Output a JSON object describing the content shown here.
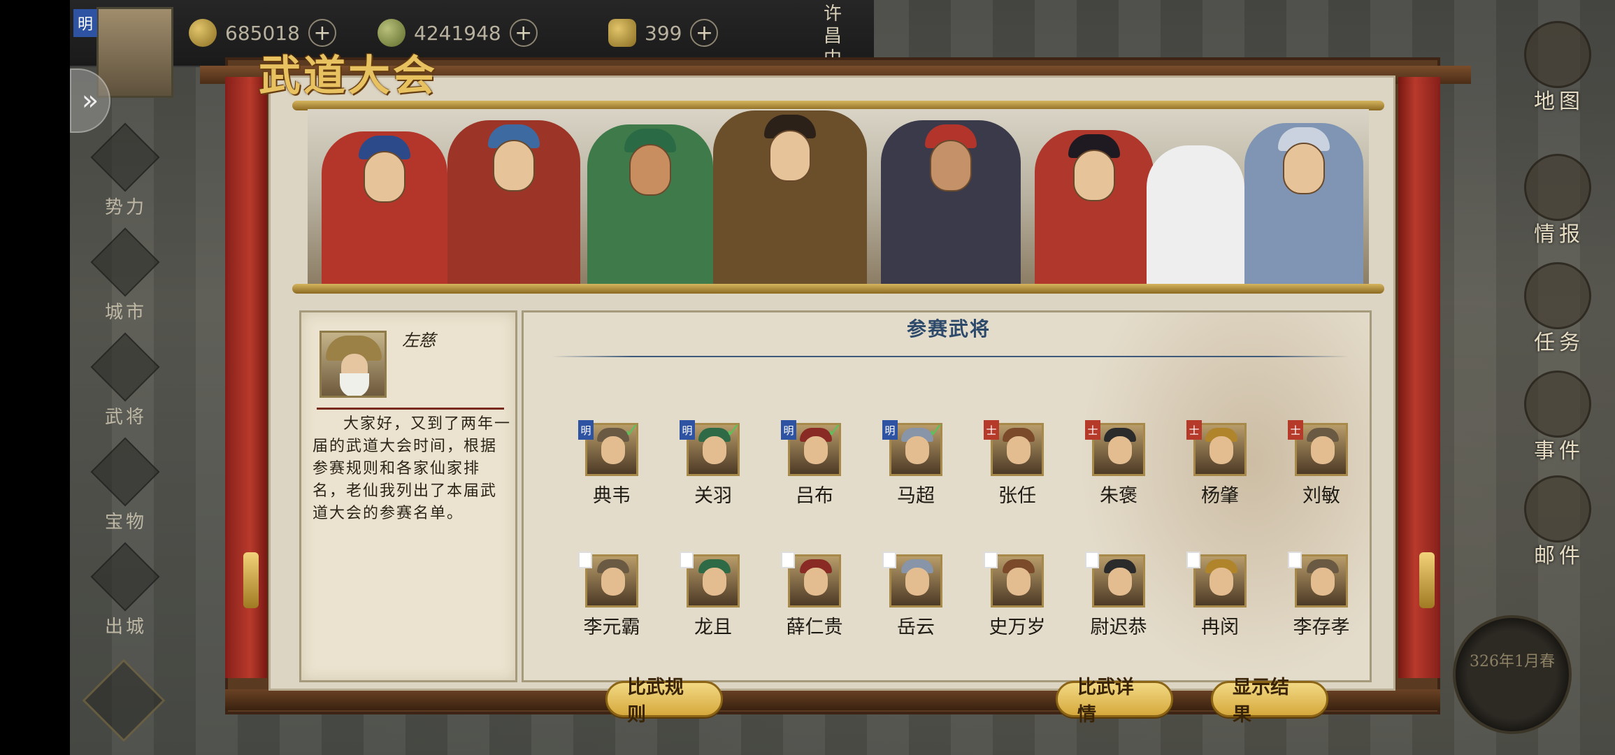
{
  "resources": {
    "coins": "685018",
    "food": "4241948",
    "ingots": "399",
    "location": "许昌中原巨"
  },
  "player": {
    "faction_badge": "明"
  },
  "left_nav": [
    {
      "label": "势力"
    },
    {
      "label": "城市"
    },
    {
      "label": "武将"
    },
    {
      "label": "宝物"
    },
    {
      "label": "出城"
    }
  ],
  "right_nav": [
    {
      "label": "地图"
    },
    {
      "label": "情报"
    },
    {
      "label": "任务"
    },
    {
      "label": "事件"
    },
    {
      "label": "邮件"
    }
  ],
  "date": "326年1月春",
  "panel": {
    "title": "武道大会",
    "roster_title": "参赛武将"
  },
  "host": {
    "name": "左慈",
    "speech": "大家好，又到了两年一届的武道大会时间，根据参赛规则和各家仙家排名，老仙我列出了本届武道大会的参赛名单。"
  },
  "generals_row1": [
    {
      "name": "典韦",
      "tag": "明",
      "checked": true
    },
    {
      "name": "关羽",
      "tag": "明",
      "checked": true
    },
    {
      "name": "吕布",
      "tag": "明",
      "checked": true
    },
    {
      "name": "马超",
      "tag": "明",
      "checked": true
    },
    {
      "name": "张任",
      "tag": "士",
      "checked": false
    },
    {
      "name": "朱褒",
      "tag": "士",
      "checked": false
    },
    {
      "name": "杨肇",
      "tag": "士",
      "checked": false
    },
    {
      "name": "刘敏",
      "tag": "士",
      "checked": false
    }
  ],
  "generals_row2": [
    {
      "name": "李元霸"
    },
    {
      "name": "龙且"
    },
    {
      "name": "薛仁贵"
    },
    {
      "name": "岳云"
    },
    {
      "name": "史万岁"
    },
    {
      "name": "尉迟恭"
    },
    {
      "name": "冉闵"
    },
    {
      "name": "李存孝"
    }
  ],
  "buttons": {
    "rules": "比武规则",
    "details": "比武详情",
    "results": "显示结果"
  },
  "colors": {
    "tag_ming": "#2f53a3",
    "tag_shi": "#b63a2a",
    "accent_gold": "#e8c161"
  }
}
